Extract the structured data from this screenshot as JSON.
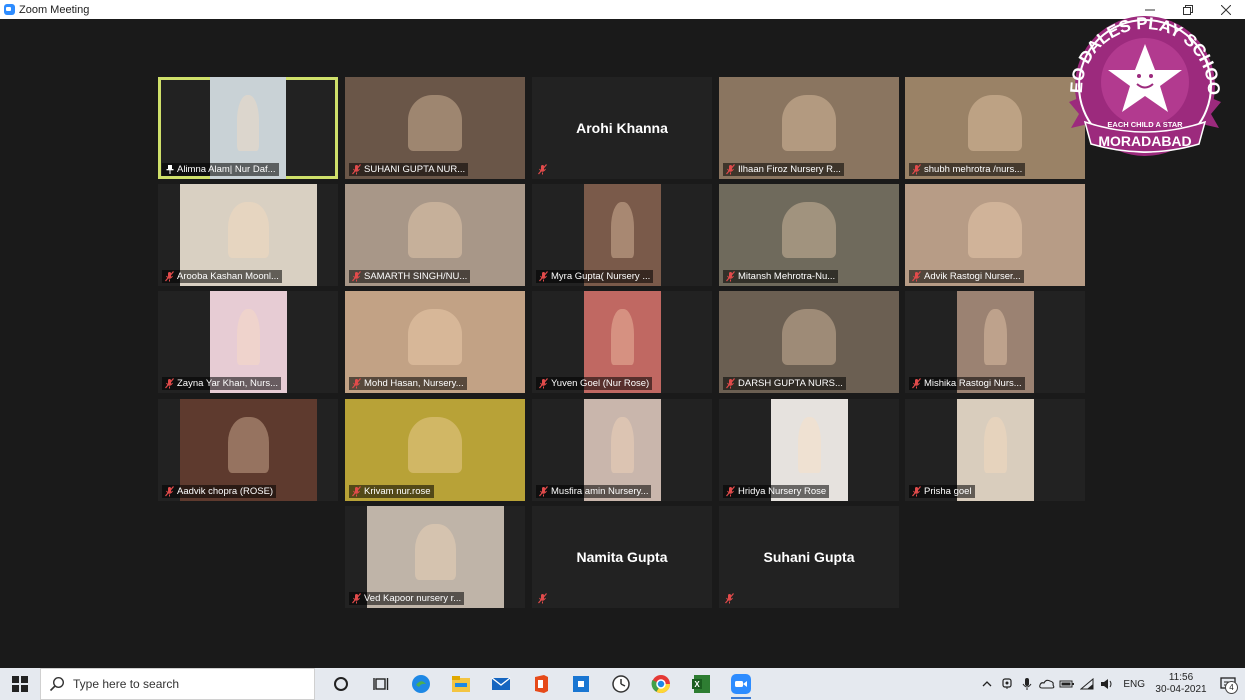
{
  "window": {
    "title": "Zoom Meeting"
  },
  "participants": [
    {
      "name": "Alimna Alam| Nur Daf...",
      "active": true,
      "pinned": true,
      "bg": "#c9d2d6",
      "vwidth": 0.42
    },
    {
      "name": "SUHANI GUPTA  NUR...",
      "bg": "#6a5648",
      "vwidth": 1.0
    },
    {
      "name": "",
      "display_name": "Arohi Khanna",
      "video": false
    },
    {
      "name": "Ilhaan Firoz Nursery R...",
      "bg": "#8a7560",
      "vwidth": 1.0
    },
    {
      "name": "shubh mehrotra /nurs...",
      "bg": "#9a8266",
      "vwidth": 1.0
    },
    {
      "name": "Arooba Kashan Moonl...",
      "bg": "#d9d0c2",
      "vwidth": 0.76
    },
    {
      "name": "SAMARTH SINGH/NU...",
      "bg": "#a89788",
      "vwidth": 1.0
    },
    {
      "name": "Myra Gupta( Nursery ...",
      "bg": "#7a5a4a",
      "vwidth": 0.43
    },
    {
      "name": "Mitansh Mehrotra-Nu...",
      "bg": "#6f6a5c",
      "vwidth": 1.0
    },
    {
      "name": "Advik Rastogi Nurser...",
      "bg": "#b79c86",
      "vwidth": 1.0
    },
    {
      "name": "Zayna Yar Khan, Nurs...",
      "bg": "#e7ccd4",
      "vwidth": 0.43
    },
    {
      "name": "Mohd Hasan, Nursery...",
      "bg": "#c2a285",
      "vwidth": 1.0
    },
    {
      "name": "Yuven Goel (Nur Rose)",
      "bg": "#c06862",
      "vwidth": 0.43
    },
    {
      "name": "DARSH GUPTA NURS...",
      "bg": "#6b5f52",
      "vwidth": 1.0
    },
    {
      "name": "Mishika Rastogi Nurs...",
      "bg": "#9b8272",
      "vwidth": 0.43
    },
    {
      "name": "Aadvik chopra (ROSE)",
      "bg": "#5e3a2e",
      "vwidth": 0.76
    },
    {
      "name": "Krivam nur.rose",
      "bg": "#b8a237",
      "vwidth": 1.0
    },
    {
      "name": "Musfira amin Nursery...",
      "bg": "#c9b6ac",
      "vwidth": 0.43
    },
    {
      "name": "Hridya Nursery Rose",
      "bg": "#e6e2de",
      "vwidth": 0.43
    },
    {
      "name": "Prisha goel",
      "bg": "#d9cdbd",
      "vwidth": 0.43
    },
    {
      "name": "Ved Kapoor nursery r...",
      "bg": "#bfb4a8",
      "vwidth": 0.76
    },
    {
      "name": "",
      "display_name": "Namita Gupta",
      "video": false
    },
    {
      "name": "",
      "display_name": "Suhani Gupta",
      "video": false
    }
  ],
  "logo": {
    "school": "NEO DALES PLAY SCHOOL",
    "tagline": "EACH CHILD A STAR",
    "city": "MORADABAD",
    "color": "#9c2a7d"
  },
  "taskbar": {
    "search_placeholder": "Type here to search",
    "language": "ENG",
    "time": "11:56",
    "date": "30-04-2021",
    "notification_count": "4"
  }
}
